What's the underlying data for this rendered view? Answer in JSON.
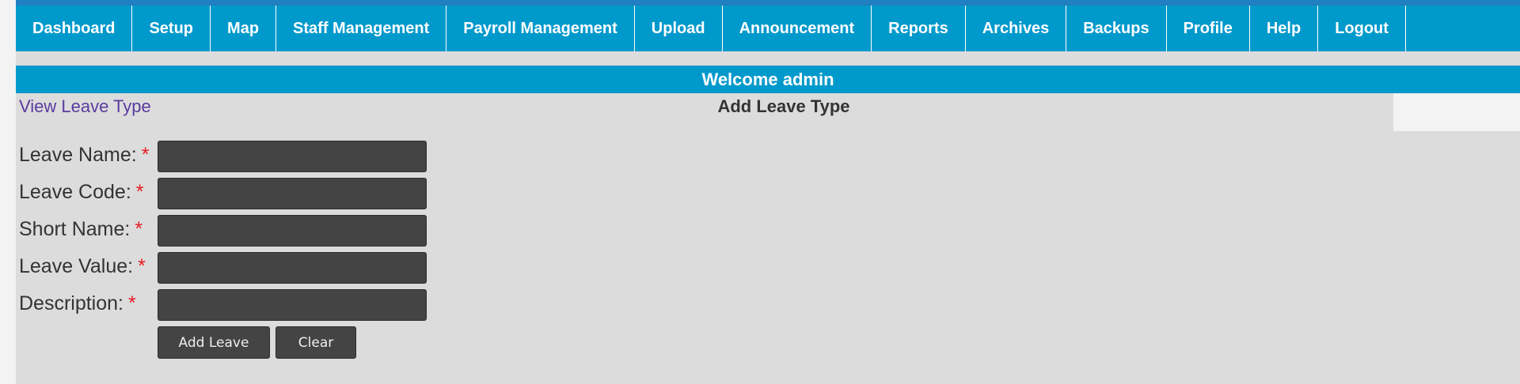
{
  "nav": {
    "items": [
      {
        "label": "Dashboard"
      },
      {
        "label": "Setup"
      },
      {
        "label": "Map"
      },
      {
        "label": "Staff Management"
      },
      {
        "label": "Payroll Management"
      },
      {
        "label": "Upload"
      },
      {
        "label": "Announcement"
      },
      {
        "label": "Reports"
      },
      {
        "label": "Archives"
      },
      {
        "label": "Backups"
      },
      {
        "label": "Profile"
      },
      {
        "label": "Help"
      },
      {
        "label": "Logout"
      }
    ]
  },
  "welcome": "Welcome admin",
  "view_link": "View Leave Type",
  "form": {
    "title": "Add Leave Type",
    "required_marker": "*",
    "fields": [
      {
        "label": "Leave Name:",
        "value": ""
      },
      {
        "label": "Leave Code:",
        "value": ""
      },
      {
        "label": "Short Name:",
        "value": ""
      },
      {
        "label": "Leave Value:",
        "value": ""
      },
      {
        "label": "Description:",
        "value": ""
      }
    ],
    "add_button": "Add Leave",
    "clear_button": "Clear"
  },
  "colors": {
    "nav_bg": "#0099cc",
    "page_bg": "#dcdcdc",
    "input_bg": "#444444",
    "required": "#e51c23",
    "link": "#5b3a9e"
  }
}
